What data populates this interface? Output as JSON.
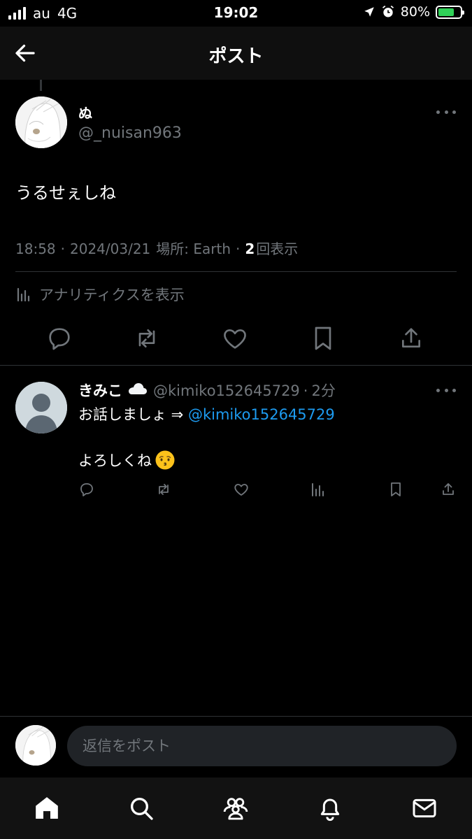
{
  "status_bar": {
    "carrier": "au",
    "network": "4G",
    "time": "19:02",
    "battery": "80%",
    "battery_level": 0.8,
    "icons": [
      "signal-icon",
      "location-icon",
      "alarm-icon",
      "battery-icon"
    ]
  },
  "header": {
    "title": "ポスト",
    "back_icon": "arrow-left-icon"
  },
  "post": {
    "display_name": "ぬ",
    "handle": "@_nuisan963",
    "text": "うるせぇしね",
    "time": "18:58",
    "sep1": "·",
    "date": "2024/03/21",
    "location": "場所: Earth",
    "sep2": "·",
    "views_count": "2",
    "views_label": "回表示",
    "analytics_label": "アナリティクスを表示",
    "actions": [
      "reply-icon",
      "repost-icon",
      "like-icon",
      "bookmark-icon",
      "share-icon"
    ]
  },
  "reply": {
    "display_name": "きみこ",
    "handle": "@kimiko152645729",
    "sep": "·",
    "age": "2分",
    "line1_text": "お話しましょ ⇒ ",
    "line1_mention": "@kimiko152645729",
    "line2_text": "よろしくね",
    "actions": [
      "reply-icon",
      "repost-icon",
      "like-icon",
      "views-icon",
      "bookmark-icon",
      "share-icon"
    ]
  },
  "composer": {
    "placeholder": "返信をポスト"
  },
  "tab_bar": [
    "home-icon",
    "search-icon",
    "communities-icon",
    "notifications-icon",
    "messages-icon"
  ],
  "colors": {
    "background": "#000000",
    "text_primary": "#e7e9ea",
    "text_secondary": "#71767b",
    "link": "#1d9bf0",
    "battery_fill": "#30d158"
  }
}
